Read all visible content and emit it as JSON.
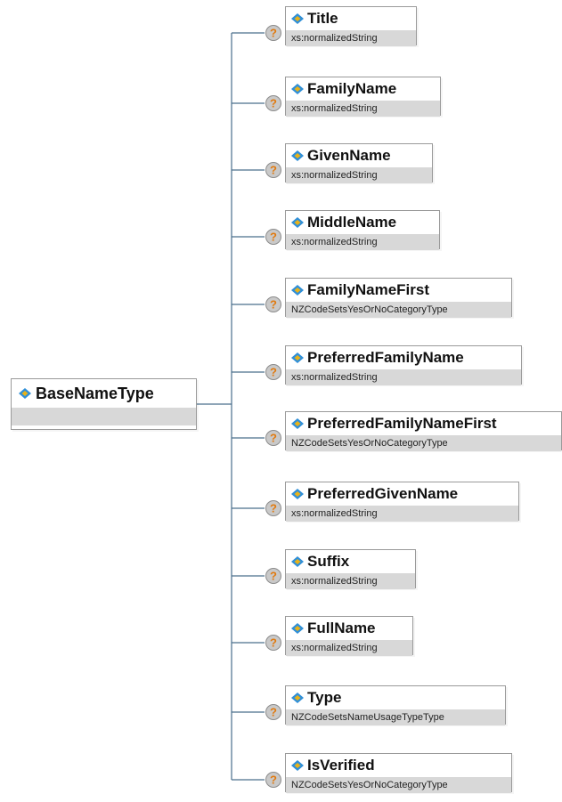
{
  "root": {
    "name": "BaseNameType",
    "type": ""
  },
  "elements": [
    {
      "name": "Title",
      "type": "xs:normalizedString"
    },
    {
      "name": "FamilyName",
      "type": "xs:normalizedString"
    },
    {
      "name": "GivenName",
      "type": "xs:normalizedString"
    },
    {
      "name": "MiddleName",
      "type": "xs:normalizedString"
    },
    {
      "name": "FamilyNameFirst",
      "type": "NZCodeSetsYesOrNoCategoryType"
    },
    {
      "name": "PreferredFamilyName",
      "type": "xs:normalizedString"
    },
    {
      "name": "PreferredFamilyNameFirst",
      "type": "NZCodeSetsYesOrNoCategoryType"
    },
    {
      "name": "PreferredGivenName",
      "type": "xs:normalizedString"
    },
    {
      "name": "Suffix",
      "type": "xs:normalizedString"
    },
    {
      "name": "FullName",
      "type": "xs:normalizedString"
    },
    {
      "name": "Type",
      "type": "NZCodeSetsNameUsageTypeType"
    },
    {
      "name": "IsVerified",
      "type": "NZCodeSetsYesOrNoCategoryType"
    }
  ],
  "optional_marker": "?",
  "colors": {
    "connector": "#4a6f8c",
    "type_bar": "#d8d8d8",
    "question_fill": "#c9c9c9",
    "gem_blue": "#2f8fd8",
    "gem_gold": "#e8b21a"
  },
  "icons": {
    "element": "element-gem-icon",
    "optional": "optional-question-icon"
  }
}
